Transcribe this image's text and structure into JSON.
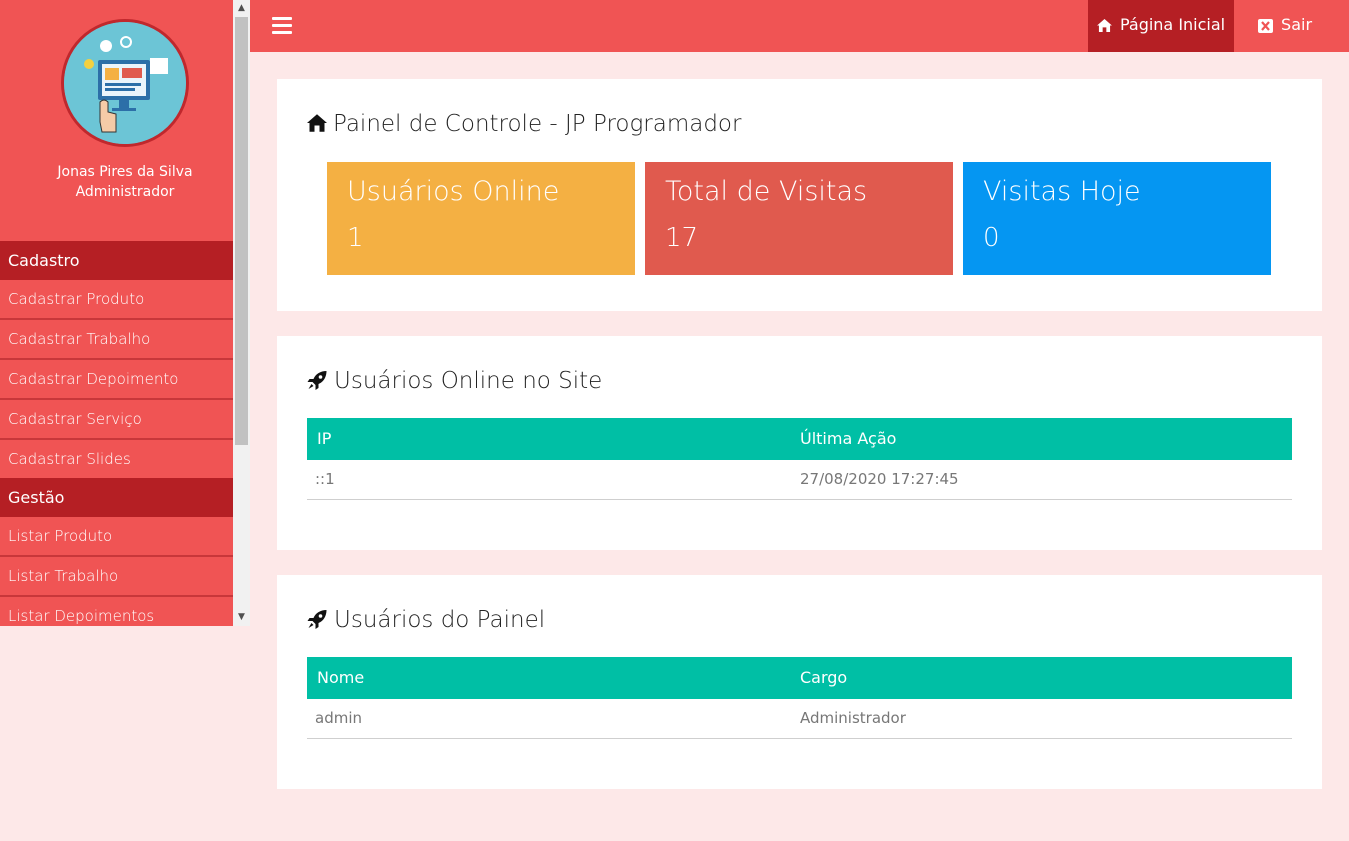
{
  "sidebar": {
    "user_name": "Jonas Pires da Silva",
    "user_role": "Administrador",
    "sections": [
      {
        "title": "Cadastro",
        "items": [
          "Cadastrar Produto",
          "Cadastrar Trabalho",
          "Cadastrar Depoimento",
          "Cadastrar Serviço",
          "Cadastrar Slides"
        ]
      },
      {
        "title": "Gestão",
        "items": [
          "Listar Produto",
          "Listar Trabalho",
          "Listar Depoimentos"
        ]
      }
    ]
  },
  "topbar": {
    "home_label": "Página Inicial",
    "exit_label": "Sair"
  },
  "dashboard": {
    "title": "Painel de Controle - JP Programador",
    "stats": [
      {
        "label": "Usuários Online",
        "value": "1",
        "color": "#f4b043"
      },
      {
        "label": "Total de Visitas",
        "value": "17",
        "color": "#e05a4e"
      },
      {
        "label": "Visitas Hoje",
        "value": "0",
        "color": "#0596f2"
      }
    ]
  },
  "online_users": {
    "title": "Usuários Online no Site",
    "columns": [
      "IP",
      "Última Ação"
    ],
    "rows": [
      [
        "::1",
        "27/08/2020 17:27:45"
      ]
    ]
  },
  "panel_users": {
    "title": "Usuários do Painel",
    "columns": [
      "Nome",
      "Cargo"
    ],
    "rows": [
      [
        "admin",
        "Administrador"
      ]
    ]
  },
  "colors": {
    "accent": "#f05454",
    "accent_dark": "#b51f24",
    "table_header": "#00bfa5",
    "background": "#fde8e8"
  },
  "icons": [
    "menu-icon",
    "home-icon",
    "close-icon",
    "rocket-icon",
    "scroll-up-icon",
    "scroll-down-icon"
  ]
}
